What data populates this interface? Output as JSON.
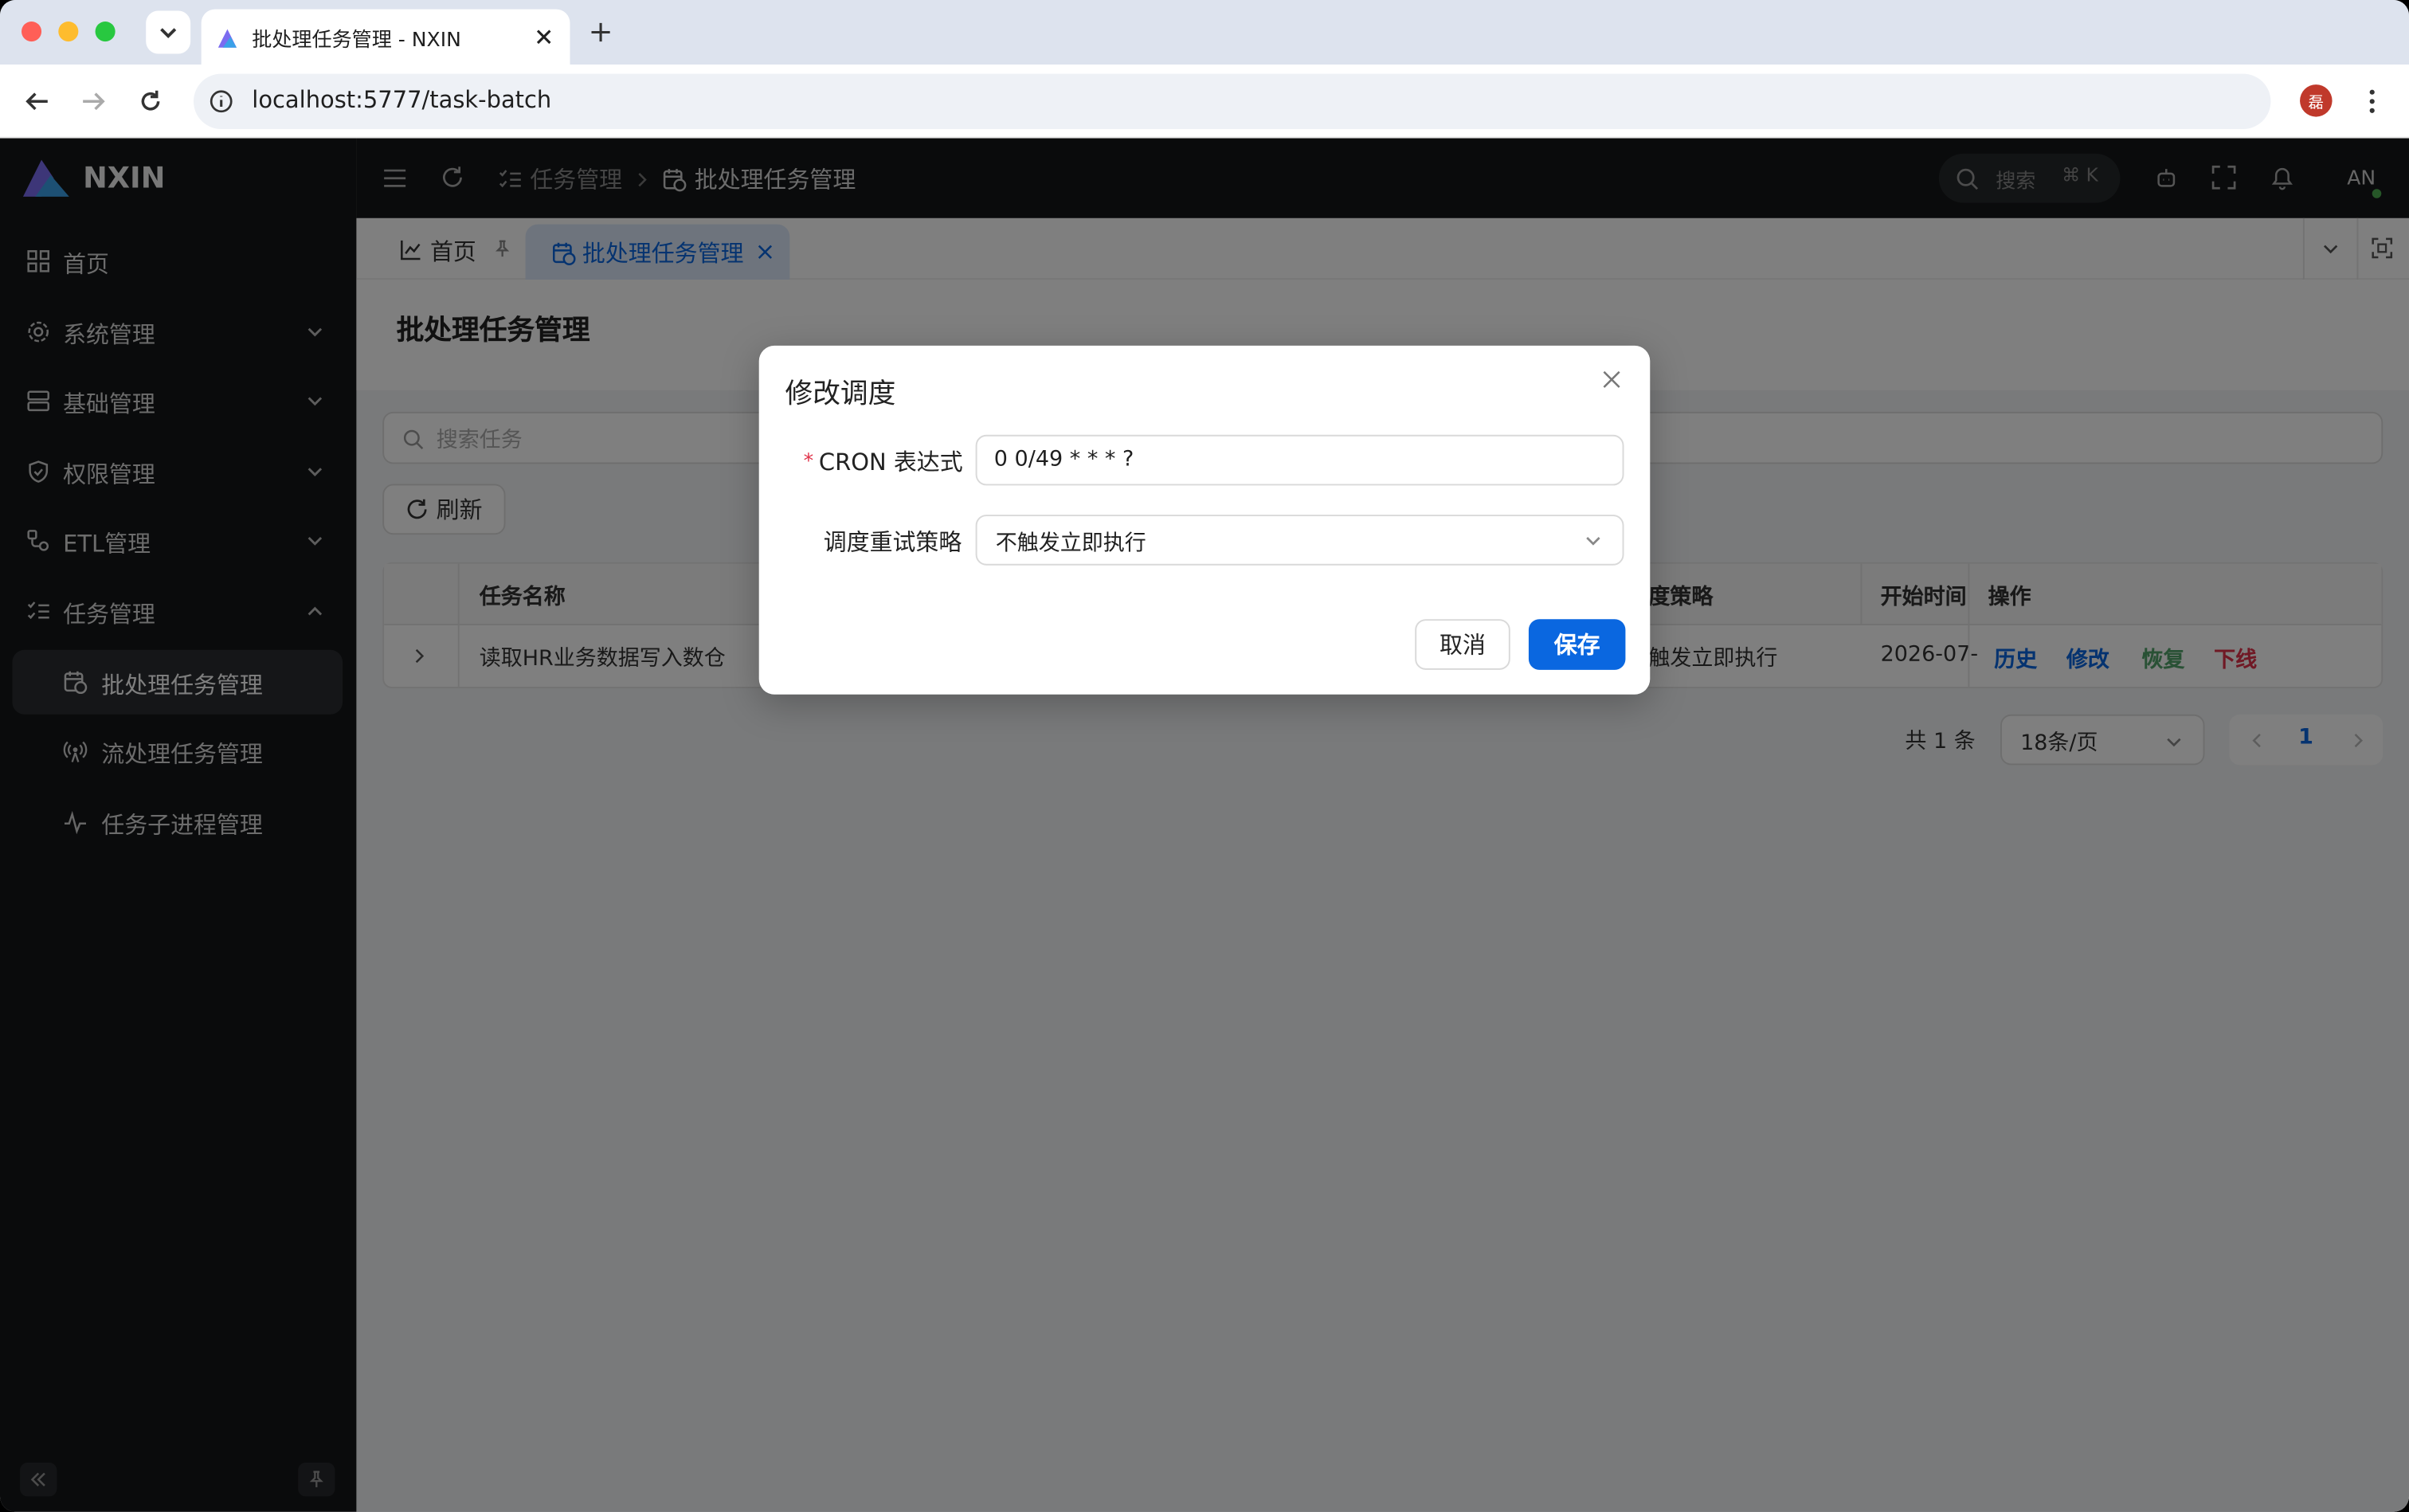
{
  "browser": {
    "tab_title": "批处理任务管理 - NXIN",
    "url": "localhost:5777/task-batch",
    "profile_initial": "磊"
  },
  "app": {
    "logo_text": "NXIN"
  },
  "sidebar": {
    "items": [
      {
        "label": "首页",
        "icon": "dashboard-icon"
      },
      {
        "label": "系统管理",
        "icon": "gear-icon"
      },
      {
        "label": "基础管理",
        "icon": "server-icon"
      },
      {
        "label": "权限管理",
        "icon": "shield-icon"
      },
      {
        "label": "ETL管理",
        "icon": "flow-icon"
      },
      {
        "label": "任务管理",
        "icon": "list-check-icon"
      }
    ],
    "sub_items": [
      {
        "label": "批处理任务管理",
        "icon": "calendar-clock-icon"
      },
      {
        "label": "流处理任务管理",
        "icon": "broadcast-icon"
      },
      {
        "label": "任务子进程管理",
        "icon": "pulse-icon"
      }
    ]
  },
  "header": {
    "breadcrumb_parent": "任务管理",
    "breadcrumb_current": "批处理任务管理",
    "search_placeholder": "搜索",
    "search_shortcut": "⌘ K",
    "avatar": "AN"
  },
  "tabs": {
    "home": "首页",
    "active": "批处理任务管理"
  },
  "page": {
    "title": "批处理任务管理",
    "search_placeholder": "搜索任务",
    "refresh_label": "刷新"
  },
  "table": {
    "headers": {
      "name": "任务名称",
      "strategy": "度策略",
      "start": "开始时间",
      "ops": "操作"
    },
    "row": {
      "name": "读取HR业务数据写入数仓",
      "strategy": "触发立即执行",
      "start": "2026-07-"
    },
    "actions": {
      "history": "历史",
      "edit": "修改",
      "resume": "恢复",
      "offline": "下线"
    }
  },
  "pagination": {
    "total": "共 1 条",
    "page_size": "18条/页",
    "current_page": "1"
  },
  "modal": {
    "title": "修改调度",
    "required_mark": "*",
    "cron_label": "CRON 表达式",
    "cron_value": "0 0/49 * * * ?",
    "retry_label": "调度重试策略",
    "retry_value": "不触发立即执行",
    "cancel": "取消",
    "save": "保存"
  },
  "colors": {
    "primary": "#0a67e0",
    "success": "#52a36b",
    "danger": "#e0334a",
    "sidebar_bg": "#151718"
  }
}
